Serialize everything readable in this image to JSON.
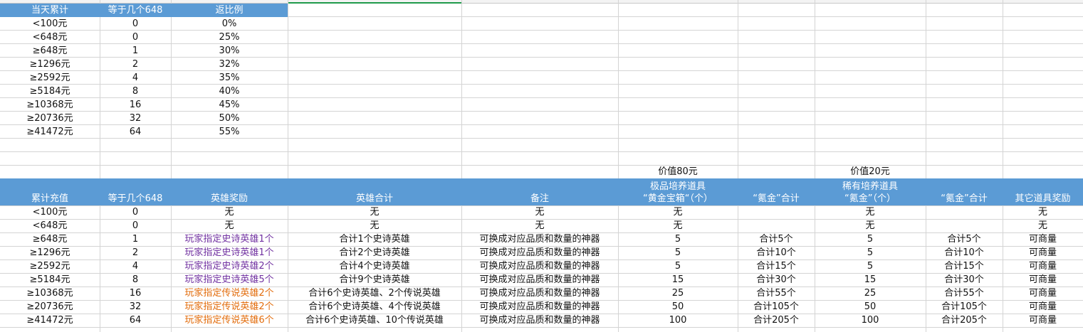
{
  "table1": {
    "headers": [
      "当天累计",
      "等于几个648",
      "返比例"
    ],
    "rows": [
      [
        "<100元",
        "0",
        "0%"
      ],
      [
        "<648元",
        "0",
        "25%"
      ],
      [
        "≥648元",
        "1",
        "30%"
      ],
      [
        "≥1296元",
        "2",
        "32%"
      ],
      [
        "≥2592元",
        "4",
        "35%"
      ],
      [
        "≥5184元",
        "8",
        "40%"
      ],
      [
        "≥10368元",
        "16",
        "45%"
      ],
      [
        "≥20736元",
        "32",
        "50%"
      ],
      [
        "≥41472元",
        "64",
        "55%"
      ]
    ]
  },
  "table2": {
    "price_labels": {
      "gold_box": "价值80元",
      "krypton": "价值20元"
    },
    "headers": [
      "累计充值",
      "等于几个648",
      "英雄奖励",
      "英雄合计",
      "备注",
      "极品培养道具\n“黄金宝箱“（个）",
      "“氪金”合计",
      "稀有培养道具\n“氪金”（个）",
      "“氪金”合计",
      "其它道具奖励"
    ],
    "rows": [
      [
        "<100元",
        "0",
        "无",
        "无",
        "无",
        "无",
        "",
        "无",
        "",
        "无"
      ],
      [
        "<648元",
        "0",
        "无",
        "无",
        "无",
        "无",
        "",
        "无",
        "",
        "无"
      ],
      [
        "≥648元",
        "1",
        "玩家指定史诗英雄1个",
        "合计1个史诗英雄",
        "可换成对应品质和数量的神器",
        "5",
        "合计5个",
        "5",
        "合计5个",
        "可商量"
      ],
      [
        "≥1296元",
        "2",
        "玩家指定史诗英雄1个",
        "合计2个史诗英雄",
        "可换成对应品质和数量的神器",
        "5",
        "合计10个",
        "5",
        "合计10个",
        "可商量"
      ],
      [
        "≥2592元",
        "4",
        "玩家指定史诗英雄2个",
        "合计4个史诗英雄",
        "可换成对应品质和数量的神器",
        "5",
        "合计15个",
        "5",
        "合计15个",
        "可商量"
      ],
      [
        "≥5184元",
        "8",
        "玩家指定史诗英雄5个",
        "合计9个史诗英雄",
        "可换成对应品质和数量的神器",
        "15",
        "合计30个",
        "15",
        "合计30个",
        "可商量"
      ],
      [
        "≥10368元",
        "16",
        "玩家指定传说英雄2个",
        "合计6个史诗英雄、2个传说英雄",
        "可换成对应品质和数量的神器",
        "25",
        "合计55个",
        "25",
        "合计55个",
        "可商量"
      ],
      [
        "≥20736元",
        "32",
        "玩家指定传说英雄2个",
        "合计6个史诗英雄、4个传说英雄",
        "可换成对应品质和数量的神器",
        "50",
        "合计105个",
        "50",
        "合计105个",
        "可商量"
      ],
      [
        "≥41472元",
        "64",
        "玩家指定传说英雄6个",
        "合计6个史诗英雄、10个传说英雄",
        "可换成对应品质和数量的神器",
        "100",
        "合计205个",
        "100",
        "合计205个",
        "可商量"
      ]
    ],
    "hero_colors": [
      "",
      "",
      "purple",
      "purple",
      "purple",
      "purple",
      "orange",
      "orange",
      "orange"
    ]
  }
}
